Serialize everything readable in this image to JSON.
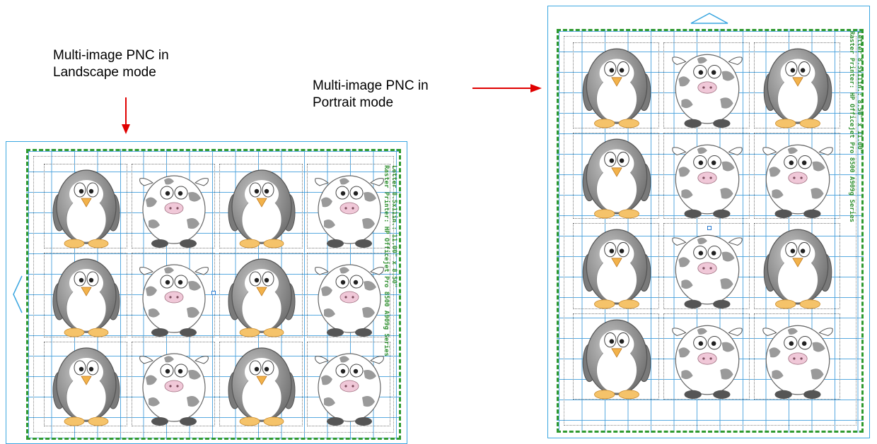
{
  "captions": {
    "landscape": {
      "line1": "Multi-image PNC in",
      "line2": "Landscape mode"
    },
    "portrait": {
      "line1": "Multi-image PNC in",
      "line2": "Portrait mode"
    }
  },
  "landscape_mat": {
    "paper_info": "Letter 8.5x11in.: 11.00\" x 8.50\"",
    "printer_info": "Raster Printer: HP Officejet Pro 8500 A909g Series",
    "arrow_icon": "triangle-left-icon",
    "grid": [
      [
        "penguin",
        "cow",
        "penguin",
        "cow"
      ],
      [
        "penguin",
        "cow",
        "penguin",
        "cow"
      ],
      [
        "penguin",
        "cow",
        "penguin",
        "cow"
      ]
    ]
  },
  "portrait_mat": {
    "paper_info": "Letter 8.5x11in.: 8.50\" x 11.00\"",
    "printer_info": "Raster Printer: HP Officejet Pro 8500 A909g Series",
    "arrow_icon": "triangle-up-icon",
    "grid": [
      [
        "penguin",
        "cow",
        "penguin"
      ],
      [
        "penguin",
        "cow",
        "cow"
      ],
      [
        "penguin",
        "cow",
        "penguin"
      ],
      [
        "penguin",
        "cow",
        "cow"
      ]
    ]
  },
  "colors": {
    "mat_border": "#3aa6e0",
    "print_area": "#2f9a2f",
    "grid_line": "#46a0dc",
    "arrow": "#e00000"
  }
}
